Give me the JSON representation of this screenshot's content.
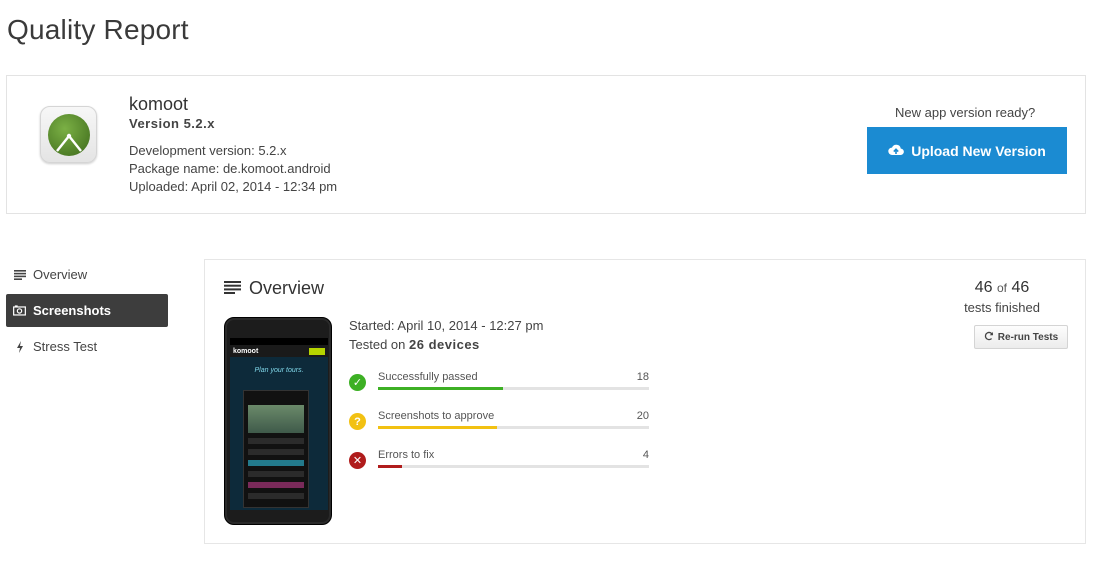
{
  "page": {
    "title": "Quality Report"
  },
  "app": {
    "name": "komoot",
    "version": "Version 5.2.x",
    "development_version": "Development version: 5.2.x",
    "package_name": "Package name: de.komoot.android",
    "uploaded": "Uploaded: April 02, 2014 - 12:34 pm",
    "icon": "komoot-app-icon"
  },
  "upload": {
    "prompt": "New app version ready?",
    "button_label": "Upload New Version",
    "icon": "cloud-upload-icon",
    "color": "#1b8bd2"
  },
  "sidebar": {
    "items": [
      {
        "label": "Overview",
        "icon": "list-icon",
        "active": false
      },
      {
        "label": "Screenshots",
        "icon": "camera-icon",
        "active": true
      },
      {
        "label": "Stress Test",
        "icon": "bolt-icon",
        "active": false
      }
    ]
  },
  "overview": {
    "title": "Overview",
    "tests_done": "46",
    "tests_of": "of",
    "tests_total": "46",
    "tests_finished_label": "tests finished",
    "rerun_label": "Re-run Tests",
    "started": "Started: April 10, 2014 - 12:27 pm",
    "tested_prefix": "Tested on",
    "tested_devices": "26 devices",
    "device_screen": {
      "logo": "komoot",
      "tagline": "Plan your tours."
    },
    "results": [
      {
        "label": "Successfully passed",
        "count": "18",
        "fraction": 0.46,
        "color": "#3db024",
        "icon": "check-circle-icon",
        "glyph": "✓"
      },
      {
        "label": "Screenshots to approve",
        "count": "20",
        "fraction": 0.44,
        "color": "#f2c112",
        "icon": "question-circle-icon",
        "glyph": "?"
      },
      {
        "label": "Errors to fix",
        "count": "4",
        "fraction": 0.09,
        "color": "#b01c1c",
        "icon": "error-circle-icon",
        "glyph": "✕"
      }
    ]
  }
}
